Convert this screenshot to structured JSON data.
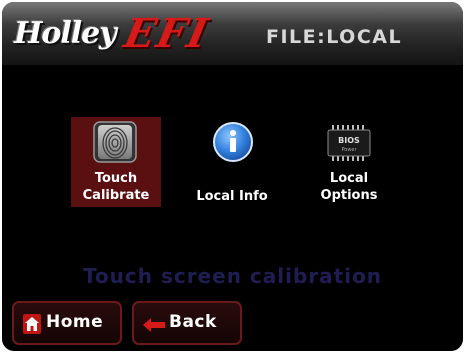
{
  "header": {
    "logo_text_1": "Holley",
    "logo_text_2": "EFI",
    "title": "FILE:LOCAL"
  },
  "menu": {
    "items": [
      {
        "label_line1": "Touch",
        "label_line2": "Calibrate",
        "icon": "fingerprint-icon",
        "selected": true
      },
      {
        "label_line1": "Local Info",
        "label_line2": "",
        "icon": "info-icon",
        "selected": false
      },
      {
        "label_line1": "Local",
        "label_line2": "Options",
        "icon": "bios-chip-icon",
        "selected": false
      }
    ],
    "bios_chip_text": "BIOS",
    "bios_chip_subtext": "Power"
  },
  "status": {
    "text": "Touch screen calibration"
  },
  "footer": {
    "home_label": "Home",
    "back_label": "Back"
  },
  "colors": {
    "background": "#000000",
    "accent_red": "#d61a1a",
    "selected_bg": "#5a1010",
    "status_text": "#1e1e52",
    "info_blue": "#2f7ddb"
  }
}
